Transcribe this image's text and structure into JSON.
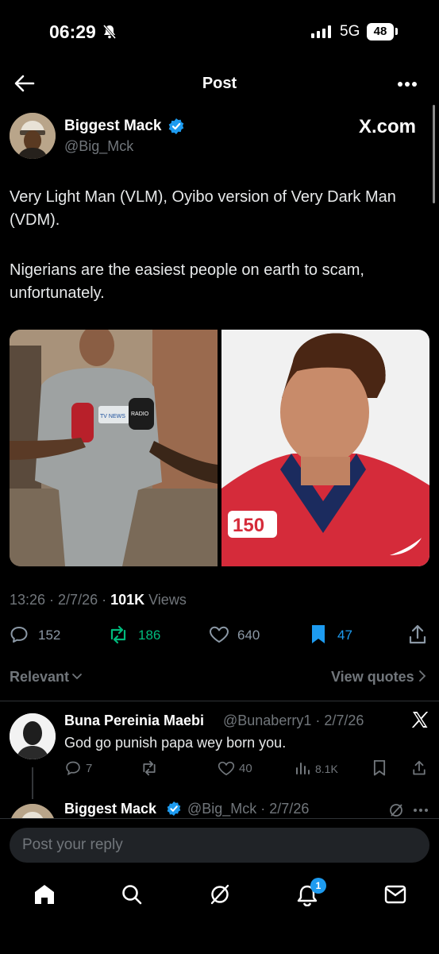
{
  "status_bar": {
    "time": "06:29",
    "network": "5G",
    "battery": "48"
  },
  "header": {
    "title": "Post"
  },
  "post": {
    "author_name": "Biggest Mack",
    "handle": "@Big_Mck",
    "source_label": "X.com",
    "text_1": "Very Light Man (VLM), Oyibo version of Very Dark Man (VDM).",
    "text_2": "Nigerians are the easiest people on earth to scam, unfortunately.",
    "mic_label_1": "TV NEWS",
    "mic_label_2": "RADIO",
    "jersey_patch": "150",
    "timestamp": "13:26 · 2/7/26 · ",
    "views_count": "101K",
    "views_label": " Views",
    "replies": "152",
    "reposts": "186",
    "likes": "640",
    "bookmarks": "47"
  },
  "sort": {
    "label": "Relevant",
    "view_quotes": "View quotes"
  },
  "reply": {
    "name": "Buna Pereinia Maebi",
    "handle_time": "@Bunaberry1 · 2/7/26",
    "text": "God go punish papa wey born you.",
    "replies": "7",
    "likes": "40",
    "views": "8.1K"
  },
  "next_reply": {
    "name": "Biggest Mack",
    "handle_time": "@Big_Mck · 2/7/26"
  },
  "compose": {
    "placeholder": "Post your reply"
  },
  "nav": {
    "notif_count": "1"
  },
  "colors": {
    "accent": "#1d9bf0",
    "repost_active": "#00ba7c",
    "muted": "#71767b"
  }
}
